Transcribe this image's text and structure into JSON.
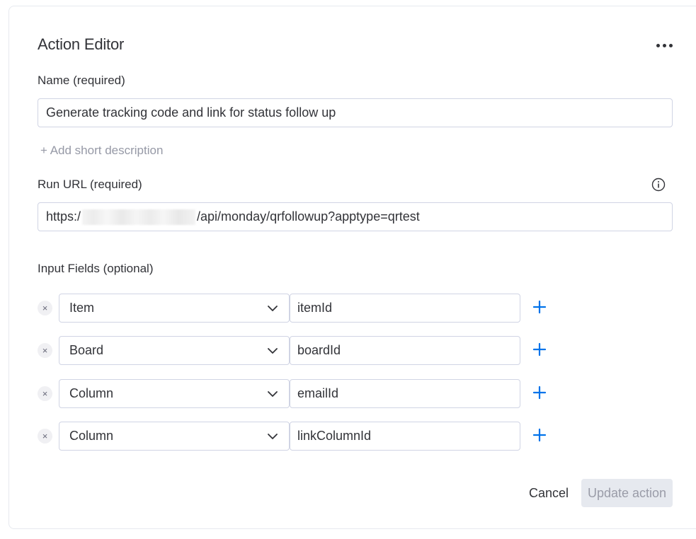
{
  "header": {
    "title": "Action Editor",
    "more_icon": "more-horizontal-icon"
  },
  "name_field": {
    "label": "Name (required)",
    "value": "Generate tracking code and link for status follow up"
  },
  "add_description": "+ Add short description",
  "run_url": {
    "label": "Run URL (required)",
    "prefix": "https:/",
    "suffix": "/api/monday/qrfollowup?apptype=qrtest",
    "info_icon": "info-icon"
  },
  "input_fields": {
    "label": "Input Fields (optional)",
    "rows": [
      {
        "type": "Item",
        "value": "itemId"
      },
      {
        "type": "Board",
        "value": "boardId"
      },
      {
        "type": "Column",
        "value": "emailId"
      },
      {
        "type": "Column",
        "value": "linkColumnId"
      }
    ],
    "remove_glyph": "×"
  },
  "footer": {
    "cancel_label": "Cancel",
    "update_label": "Update action"
  },
  "colors": {
    "text": "#323338",
    "border": "#d0d4e4",
    "accent": "#0073ea",
    "muted": "#9699a6",
    "disabled_bg": "#e6e9ef",
    "disabled_text": "#9a9ca8"
  }
}
